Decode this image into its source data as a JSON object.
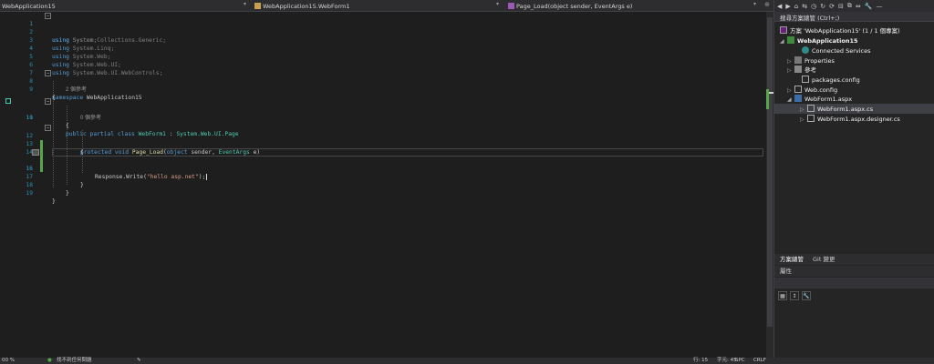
{
  "navbar": {
    "project_dd": "WebApplication15",
    "class_dd": "WebApplication15.WebForm1",
    "member_dd": "Page_Load(object sender, EventArgs e)"
  },
  "code": {
    "l1_kw": "using",
    "l1_ns": " System;",
    "l2_kw": "using",
    "l2_ns": " System.Collections.Generic;",
    "l3_kw": "using",
    "l3_ns": " System.Linq;",
    "l4_kw": "using",
    "l4_ns": " System.Web;",
    "l5_kw": "using",
    "l5_ns": " System.Web.UI;",
    "l6_kw": "using",
    "l6_ns": " System.Web.UI.WebControls;",
    "l8_kw": "namespace",
    "l8_ns": " WebApplication15",
    "l9": "{",
    "lens1": "2 個參考",
    "l10_kw": "public partial class",
    "l10_cls": " WebForm1",
    "l10_sep": " : ",
    "l10_base": "System.Web.UI.Page",
    "l11": "{",
    "lens2": "0 個參考",
    "l12_kw": "protected void",
    "l12_fn": " Page_Load",
    "l12_p1": "(",
    "l12_k2": "object",
    "l12_p2": " sender, ",
    "l12_ty": "EventArgs",
    "l12_p3": " e)",
    "l13": "{",
    "l15_a": "Response.Write(",
    "l15_str": "\"hello asp.net\"",
    "l15_b": ");",
    "l17": "}",
    "l18": "}",
    "l19": "}"
  },
  "line_numbers": [
    "1",
    "2",
    "3",
    "4",
    "5",
    "6",
    "7",
    "8",
    "9",
    "10",
    "11",
    "12",
    "13",
    "14",
    "15",
    "16",
    "17",
    "18",
    "19"
  ],
  "solution": {
    "search_placeholder": "搜尋方案總管 (Ctrl+;)",
    "solution_label": "方案 'WebApplication15' (1 / 1 個專案)",
    "project": "WebApplication15",
    "connected_services": "Connected Services",
    "properties": "Properties",
    "references": "參考",
    "packages": "packages.config",
    "webconfig": "Web.config",
    "webform": "WebForm1.aspx",
    "webform_cs": "WebForm1.aspx.cs",
    "webform_designer": "WebForm1.aspx.designer.cs"
  },
  "panel_tabs": {
    "solution_explorer": "方案總管",
    "git_changes": "Git 變更"
  },
  "properties_panel": {
    "title": "屬性"
  },
  "statusbar": {
    "zoom": "00 %",
    "issues": "找不到任何問題",
    "line": "行: 15",
    "col": "字元: 45",
    "spc": "SPC",
    "crlf": "CRLF"
  },
  "colors": {
    "keyword": "#569cd6",
    "type": "#4ec9b0",
    "string": "#d69d85",
    "line_number": "#2b91af",
    "change_marker": "#57a64a"
  }
}
